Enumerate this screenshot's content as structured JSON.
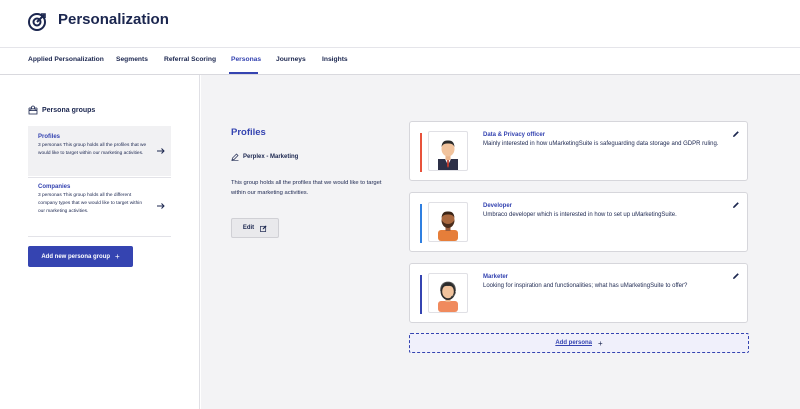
{
  "header": {
    "title": "Personalization",
    "icon": "target-icon"
  },
  "tabs": [
    {
      "label": "Applied Personalization",
      "active": false
    },
    {
      "label": "Segments",
      "active": false
    },
    {
      "label": "Referral Scoring",
      "active": false
    },
    {
      "label": "Personas",
      "active": true
    },
    {
      "label": "Journeys",
      "active": false
    },
    {
      "label": "Insights",
      "active": false
    }
  ],
  "sidebar": {
    "heading": "Persona groups",
    "groups": [
      {
        "name": "Profiles",
        "description": "3 personas  This group holds all the profiles that we would like to target within our marketing activities.",
        "selected": true
      },
      {
        "name": "Companies",
        "description": "3 personas  This group holds all the different company types that we would like to target within our marketing activities.",
        "selected": false
      }
    ],
    "add_button": "Add new persona group",
    "add_symbol": "+"
  },
  "detail": {
    "title": "Profiles",
    "owner": "Perplex - Marketing",
    "description": "This group holds all the profiles that we would like to target within our marketing activities.",
    "edit_button": "Edit"
  },
  "personas": [
    {
      "name": "Data & Privacy officer",
      "description": "Mainly interested in how uMarketingSuite is safeguarding data storage and GDPR ruling.",
      "color": "#e8523b",
      "avatar": "man-with-tie-avatar"
    },
    {
      "name": "Developer",
      "description": "Umbraco developer which is interested in how to set up uMarketingSuite.",
      "color": "#2f7fe0",
      "avatar": "man-with-beard-avatar"
    },
    {
      "name": "Marketer",
      "description": "Looking for inspiration and functionalities; what has uMarketingSuite to offer?",
      "color": "#3544b1",
      "avatar": "woman-with-headset-avatar"
    }
  ],
  "add_persona": {
    "label": "Add persona",
    "symbol": "+"
  },
  "colors": {
    "accent": "#3544b1",
    "text": "#1b264f",
    "main_bg": "#f3f3f5"
  }
}
